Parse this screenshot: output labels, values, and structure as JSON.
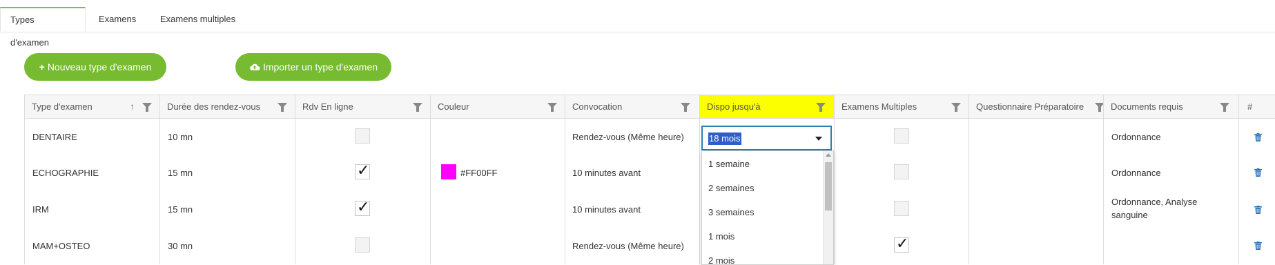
{
  "tabs": [
    {
      "label": "Types d'examen",
      "active": true
    },
    {
      "label": "Examens"
    },
    {
      "label": "Examens multiples"
    }
  ],
  "buttons": {
    "new_type": {
      "icon": "plus-icon",
      "label": "Nouveau type d'examen"
    },
    "import_type": {
      "icon": "cloud-upload-icon",
      "label": "Importer un type d'examen"
    }
  },
  "table": {
    "columns": [
      {
        "label": "Type d'examen",
        "sort": "ascending",
        "filter": true
      },
      {
        "label": "Durée des rendez-vous",
        "filter": true
      },
      {
        "label": "Rdv En ligne",
        "filter": true
      },
      {
        "label": "Couleur",
        "filter": true
      },
      {
        "label": "Convocation",
        "filter": true
      },
      {
        "label": "Dispo jusqu'à",
        "filter": true,
        "highlighted": true
      },
      {
        "label": "Examens Multiples",
        "filter": true
      },
      {
        "label": "Questionnaire Préparatoire",
        "filter": true
      },
      {
        "label": "Documents requis",
        "filter": true
      },
      {
        "label": "#"
      }
    ],
    "rows": [
      {
        "type": "DENTAIRE",
        "duree": "10 mn",
        "rdv_en_ligne": false,
        "couleur": "",
        "convocation": "Rendez-vous (Même heure)",
        "dispo": "18 mois",
        "examens_multiples": false,
        "questionnaire": "",
        "documents": "Ordonnance"
      },
      {
        "type": "ECHOGRAPHIE",
        "duree": "15 mn",
        "rdv_en_ligne": true,
        "couleur": "#FF00FF",
        "convocation": "10 minutes avant",
        "dispo": "",
        "examens_multiples": false,
        "questionnaire": "",
        "documents": "Ordonnance"
      },
      {
        "type": "IRM",
        "duree": "15 mn",
        "rdv_en_ligne": true,
        "couleur": "",
        "convocation": "10 minutes avant",
        "dispo": "",
        "examens_multiples": false,
        "questionnaire": "",
        "documents": "Ordonnance, Analyse sanguine"
      },
      {
        "type": "MAM+OSTEO",
        "duree": "30 mn",
        "rdv_en_ligne": false,
        "couleur": "",
        "convocation": "Rendez-vous (Même heure)",
        "dispo": "",
        "examens_multiples": true,
        "questionnaire": "",
        "documents": ""
      }
    ]
  },
  "dispo_select": {
    "value": "18 mois",
    "options": [
      "1 semaine",
      "2 semaines",
      "3 semaines",
      "1 mois",
      "2 mois"
    ]
  },
  "colors": {
    "accent": "#76bb30",
    "header_highlight": "#fbff00",
    "focus_border": "#2a7fb5",
    "selection": "#2f5ec9",
    "trash_icon": "#2a6fb5"
  },
  "icons": {
    "delete": "trash-icon",
    "filter": "filter-icon",
    "sort": "sort-ascending-icon"
  }
}
